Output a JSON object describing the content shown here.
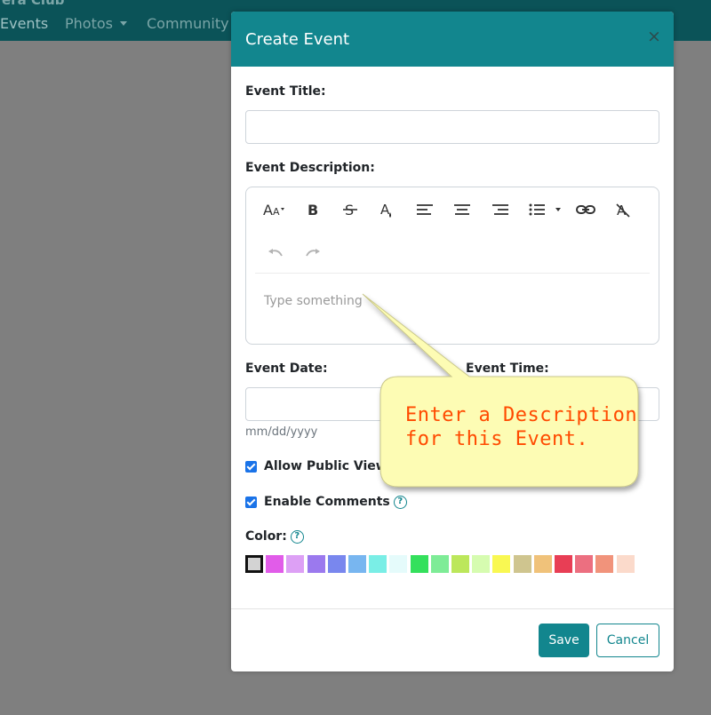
{
  "navbar": {
    "brand": "era Club",
    "items": [
      {
        "label": "Events"
      },
      {
        "label": "Photos"
      },
      {
        "label": "Community"
      }
    ]
  },
  "modal": {
    "title": "Create Event",
    "close_icon": "close-icon",
    "header_color": "#12868e"
  },
  "form": {
    "title_label": "Event Title:",
    "title_value": "",
    "description_label": "Event Description:",
    "editor_placeholder": "Type something",
    "toolbar_icons": [
      "font-size-icon",
      "bold-icon",
      "strikethrough-icon",
      "text-color-icon",
      "align-left-icon",
      "align-center-icon",
      "align-right-icon",
      "list-icon",
      "link-icon",
      "clear-format-icon",
      "undo-icon",
      "redo-icon"
    ],
    "date_label": "Event Date:",
    "date_help": "mm/dd/yyyy",
    "time_label": "Event Time:",
    "public_label": "Allow Public Viewing",
    "public_checked": true,
    "comments_label": "Enable Comments",
    "comments_checked": true,
    "color_label": "Color:",
    "colors": [
      "#d3d3d3",
      "#e15ce9",
      "#dda0f5",
      "#9b79ee",
      "#7987ee",
      "#78b6f0",
      "#7aeee6",
      "#e5fbfb",
      "#34e05c",
      "#7eec97",
      "#bce75b",
      "#d6fcb0",
      "#f9f852",
      "#cfc58f",
      "#f0c27a",
      "#e83e55",
      "#ec6f80",
      "#f1937b",
      "#fbdacb"
    ],
    "selected_color_index": 0
  },
  "footer": {
    "save_label": "Save",
    "cancel_label": "Cancel"
  },
  "callout": {
    "line1": "Enter a Description",
    "line2": "for this Event."
  }
}
